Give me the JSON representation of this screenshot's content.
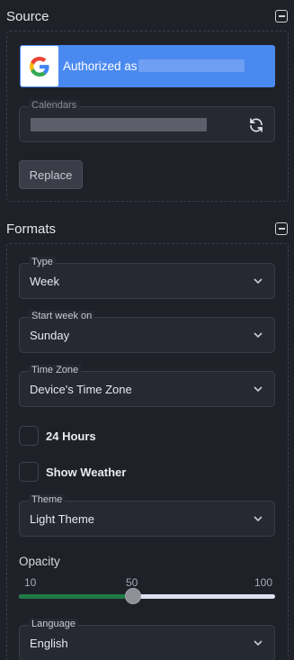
{
  "source": {
    "title": "Source",
    "google_button_label": "Authorized as",
    "calendars_label": "Calendars",
    "replace_label": "Replace"
  },
  "formats": {
    "title": "Formats",
    "type": {
      "label": "Type",
      "value": "Week"
    },
    "start_week": {
      "label": "Start week on",
      "value": "Sunday"
    },
    "time_zone": {
      "label": "Time Zone",
      "value": "Device's Time Zone"
    },
    "hours24": {
      "label": "24 Hours",
      "checked": false
    },
    "weather": {
      "label": "Show Weather",
      "checked": false
    },
    "theme": {
      "label": "Theme",
      "value": "Light Theme"
    },
    "opacity": {
      "label": "Opacity",
      "min": "10",
      "mid": "50",
      "max": "100",
      "value": 50
    },
    "language": {
      "label": "Language",
      "value": "English"
    }
  },
  "colors": {
    "background": "#1f2129",
    "google_blue": "#4a89f0",
    "slider_fill": "#1e7b45"
  },
  "icons": [
    "collapse-icon",
    "google-logo-icon",
    "refresh-icon",
    "chevron-down-icon"
  ]
}
